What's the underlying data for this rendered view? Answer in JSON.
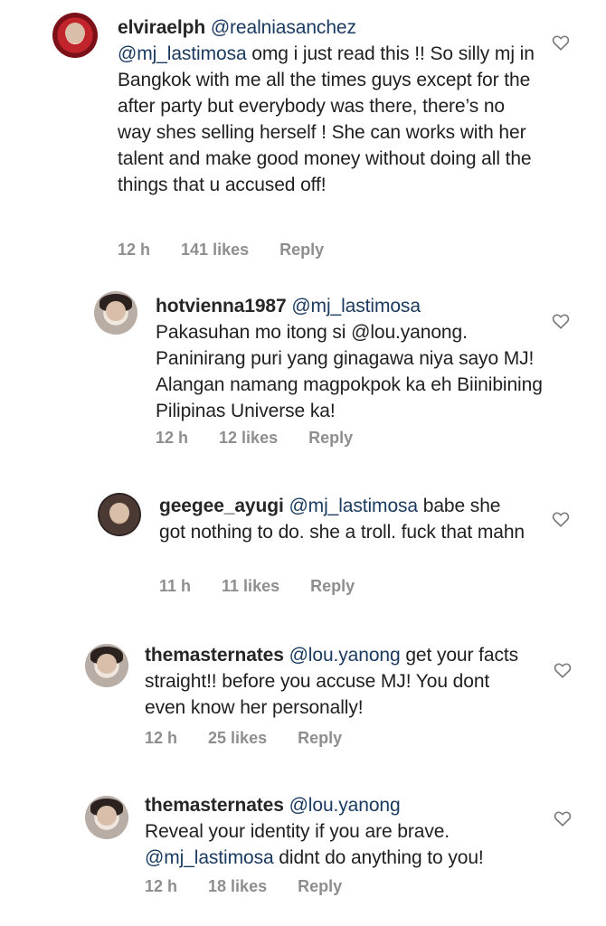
{
  "comments": [
    {
      "username": "elviraelph",
      "mention": "@realniasanchez",
      "body_mention": "@mj_lastimosa",
      "body": " omg i just read this !! So silly mj in Bangkok with me all the times guys except for the after party but everybody was there, there’s no way shes selling herself ! She can works with her talent and make good money without doing all the things that u accused off!",
      "time": "12 h",
      "likes": "141 likes",
      "reply": "Reply",
      "avatar_icon": "profile-avatar"
    },
    {
      "username": "hotvienna1987",
      "mention": "@mj_lastimosa",
      "body": "Pakasuhan mo itong si @lou.yanong. Paninirang puri yang ginagawa niya sayo MJ! Alangan namang magpokpok ka eh Biinibining Pilipinas Universe ka!",
      "time": "12 h",
      "likes": "12 likes",
      "reply": "Reply",
      "avatar_icon": "profile-avatar"
    },
    {
      "username": "geegee_ayugi",
      "mention": "@mj_lastimosa",
      "body": " babe she got nothing to do. she a troll. fuck that mahn",
      "time": "11 h",
      "likes": "11 likes",
      "reply": "Reply",
      "avatar_icon": "profile-avatar"
    },
    {
      "username": "themasternates",
      "mention": "@lou.yanong",
      "body": " get your facts straight!! before you accuse MJ! You dont even know her personally!",
      "time": "12 h",
      "likes": "25 likes",
      "reply": "Reply",
      "avatar_icon": "profile-avatar"
    },
    {
      "username": "themasternates",
      "mention": "@lou.yanong",
      "body_line": "Reveal your identity if you are brave.",
      "body_mention": "@mj_lastimosa",
      "body": " didnt do anything to you!",
      "time": "12 h",
      "likes": "18 likes",
      "reply": "Reply",
      "avatar_icon": "profile-avatar"
    }
  ],
  "like_icon": "heart-outline-icon"
}
